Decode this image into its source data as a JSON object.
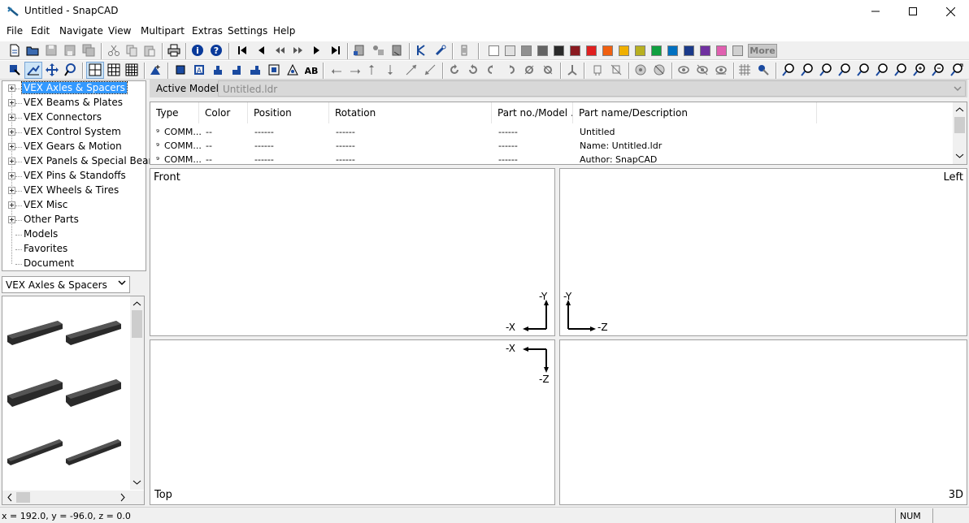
{
  "window": {
    "title": "Untitled - SnapCAD"
  },
  "menu": [
    "File",
    "Edit",
    "Navigate",
    "View",
    "Multipart",
    "Extras",
    "Settings",
    "Help"
  ],
  "palette": {
    "colors": [
      "#ffffff",
      "#e0e0e0",
      "#909090",
      "#646464",
      "#2a2a2a",
      "#8a1a20",
      "#e02020",
      "#f06010",
      "#f0b000",
      "#b8b020",
      "#10a040",
      "#0070c0",
      "#1a3a8a",
      "#7030a0",
      "#e060b0",
      "#d0d0d0"
    ],
    "more_label": "More"
  },
  "tree": {
    "items": [
      {
        "label": "VEX Axles & Spacers",
        "expandable": true,
        "selected": true
      },
      {
        "label": "VEX Beams & Plates",
        "expandable": true
      },
      {
        "label": "VEX Connectors",
        "expandable": true
      },
      {
        "label": "VEX Control System",
        "expandable": true
      },
      {
        "label": "VEX Gears & Motion",
        "expandable": true
      },
      {
        "label": "VEX Panels & Special Beams",
        "expandable": true
      },
      {
        "label": "VEX Pins & Standoffs",
        "expandable": true
      },
      {
        "label": "VEX Wheels & Tires",
        "expandable": true
      },
      {
        "label": "VEX Misc",
        "expandable": true
      },
      {
        "label": "Other Parts",
        "expandable": true
      },
      {
        "label": "Models",
        "expandable": false
      },
      {
        "label": "Favorites",
        "expandable": false
      },
      {
        "label": "Document",
        "expandable": false
      }
    ]
  },
  "parts_combo": {
    "value": "VEX Axles & Spacers"
  },
  "active_model": {
    "label": "Active Model:",
    "value": "Untitled.ldr"
  },
  "list": {
    "columns": [
      "Type",
      "Color",
      "Position",
      "Rotation",
      "Part no./Model ...",
      "Part name/Description"
    ],
    "rows": [
      [
        "COMM...",
        "--",
        "------",
        "------",
        "------",
        "Untitled"
      ],
      [
        "COMM...",
        "--",
        "------",
        "------",
        "------",
        "Name: Untitled.ldr"
      ],
      [
        "COMM...",
        "--",
        "------",
        "------",
        "------",
        "Author: SnapCAD"
      ]
    ]
  },
  "viewports": {
    "front": {
      "label": "Front",
      "axis_h": "-X",
      "axis_v": "-Y"
    },
    "left": {
      "label": "Left",
      "axis_h": "-Z",
      "axis_v": "-Y"
    },
    "top": {
      "label": "Top",
      "axis_h": "-X",
      "axis_v": "-Z"
    },
    "view3d": {
      "label": "3D"
    }
  },
  "status": {
    "coords": "x = 192.0, y = -96.0, z = 0.0",
    "num": "NUM"
  }
}
